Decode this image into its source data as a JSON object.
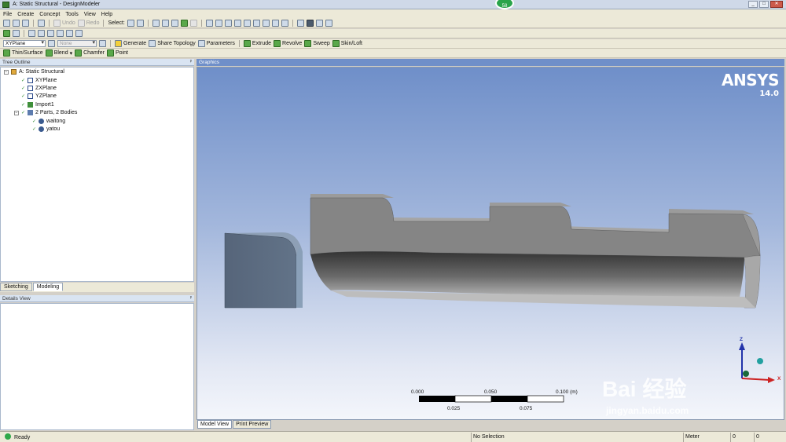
{
  "window": {
    "title": "A: Static Structural - DesignModeler",
    "badge": "58"
  },
  "menu": [
    "File",
    "Create",
    "Concept",
    "Tools",
    "View",
    "Help"
  ],
  "toolbar1": {
    "undo": "Undo",
    "redo": "Redo",
    "select": "Select:"
  },
  "toolbar3": {
    "plane_value": "XYPlane",
    "sketch_value": "None",
    "generate": "Generate",
    "share_topology": "Share Topology",
    "parameters": "Parameters",
    "extrude": "Extrude",
    "revolve": "Revolve",
    "sweep": "Sweep",
    "skin_loft": "Skin/Loft"
  },
  "toolbar4": {
    "thin_surface": "Thin/Surface",
    "blend": "Blend",
    "chamfer": "Chamfer",
    "point": "Point"
  },
  "tree": {
    "header": "Tree Outline",
    "root": "A: Static Structural",
    "items": [
      "XYPlane",
      "ZXPlane",
      "YZPlane",
      "Import1",
      "2 Parts, 2 Bodies"
    ],
    "bodies": [
      "waitong",
      "yatou"
    ]
  },
  "panel_tabs": [
    "Sketching",
    "Modeling"
  ],
  "details": {
    "header": "Details View"
  },
  "graphics": {
    "header": "Graphics",
    "brand": "ANSYS",
    "version": "14.0",
    "scale_top": [
      "0.000",
      "0.050",
      "0.100 (m)"
    ],
    "scale_bottom": [
      "0.025",
      "0.075"
    ],
    "axes": {
      "z": "Z",
      "x": "X"
    },
    "watermark": "Bai 经验",
    "watermark_url": "jingyan.baidu.com"
  },
  "graphics_tabs": [
    "Model View",
    "Print Preview"
  ],
  "status": {
    "ready": "Ready",
    "selection": "No Selection",
    "units": "Meter",
    "val1": "0",
    "val2": "0"
  }
}
